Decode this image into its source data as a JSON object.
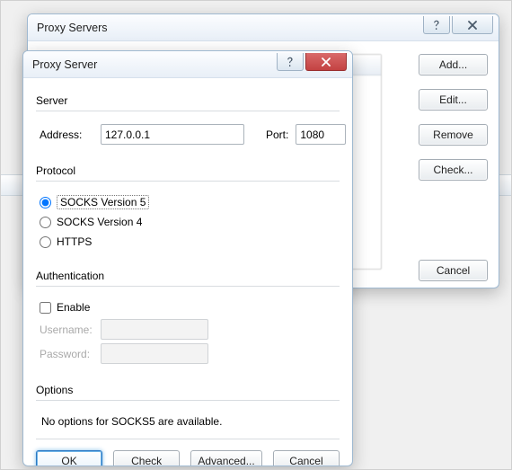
{
  "background": {
    "title": "Proxy Servers",
    "buttons": {
      "add": "Add...",
      "edit": "Edit...",
      "remove": "Remove",
      "check": "Check...",
      "cancel": "Cancel"
    }
  },
  "dialog": {
    "title": "Proxy Server",
    "server": {
      "group_label": "Server",
      "address_label": "Address:",
      "address_value": "127.0.0.1",
      "port_label": "Port:",
      "port_value": "1080"
    },
    "protocol": {
      "group_label": "Protocol",
      "options": {
        "socks5": "SOCKS Version 5",
        "socks4": "SOCKS Version 4",
        "https": "HTTPS"
      },
      "selected": "socks5"
    },
    "auth": {
      "group_label": "Authentication",
      "enable_label": "Enable",
      "enabled": false,
      "username_label": "Username:",
      "username_value": "",
      "password_label": "Password:",
      "password_value": ""
    },
    "options": {
      "group_label": "Options",
      "note": "No options for SOCKS5 are available."
    },
    "footer": {
      "ok": "OK",
      "check": "Check",
      "advanced": "Advanced...",
      "cancel": "Cancel"
    }
  }
}
